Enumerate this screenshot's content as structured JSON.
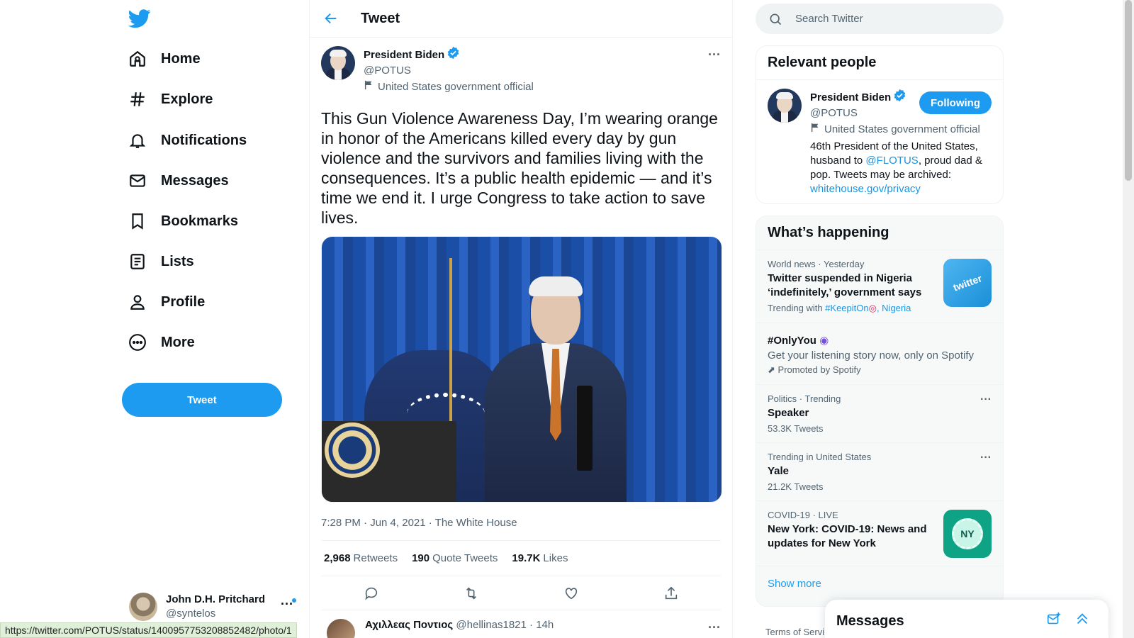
{
  "nav": {
    "items": [
      {
        "label": "Home",
        "icon": "home-icon"
      },
      {
        "label": "Explore",
        "icon": "hashtag-icon"
      },
      {
        "label": "Notifications",
        "icon": "bell-icon"
      },
      {
        "label": "Messages",
        "icon": "envelope-icon"
      },
      {
        "label": "Bookmarks",
        "icon": "bookmark-icon"
      },
      {
        "label": "Lists",
        "icon": "list-icon"
      },
      {
        "label": "Profile",
        "icon": "person-icon"
      },
      {
        "label": "More",
        "icon": "more-circle-icon"
      }
    ],
    "tweet_button": "Tweet"
  },
  "account": {
    "name": "John D.H. Pritchard",
    "handle": "@syntelos"
  },
  "header": {
    "title": "Tweet"
  },
  "tweet": {
    "author_name": "President Biden",
    "author_handle": "@POTUS",
    "gov_label": "United States government official",
    "text": "This Gun Violence Awareness Day, I’m wearing orange in honor of the Americans killed every day by gun violence and the survivors and families living with the consequences. It’s a public health epidemic — and it’s time we end it. I urge Congress to take action to save lives.",
    "time": "7:28 PM · Jun 4, 2021 · ",
    "source": "The White House",
    "retweets_count": "2,968",
    "retweets_label": "Retweets",
    "quotes_count": "190",
    "quotes_label": "Quote Tweets",
    "likes_count": "19.7K",
    "likes_label": "Likes"
  },
  "reply": {
    "name": "Αχιλλεας Ποντιος",
    "handle": "@hellinas1821",
    "time": "· 14h"
  },
  "search": {
    "placeholder": "Search Twitter"
  },
  "relevant": {
    "title": "Relevant people",
    "name": "President Biden",
    "handle": "@POTUS",
    "gov_label": "United States government official",
    "bio_1": "46th President of the United States, husband to ",
    "bio_mention": "@FLOTUS",
    "bio_2": ", proud dad & pop. Tweets may be archived: ",
    "bio_link": "whitehouse.gov/privacy",
    "follow_label": "Following"
  },
  "happening": {
    "title": "What’s happening",
    "trends": [
      {
        "context": "World news · Yesterday",
        "title": "Twitter suspended in Nigeria ‘indefinitely,’ government says",
        "trending_with": "Trending with ",
        "tags": "#KeepitOn",
        "tags2": ", Nigeria"
      },
      {
        "title": "#OnlyYou",
        "desc": "Get your listening story now, only on Spotify",
        "promoted": "Promoted by Spotify"
      },
      {
        "context": "Politics · Trending",
        "title": "Speaker",
        "count": "53.3K Tweets"
      },
      {
        "context": "Trending in United States",
        "title": "Yale",
        "count": "21.2K Tweets"
      },
      {
        "context": "COVID-19 · LIVE",
        "title": "New York: COVID-19: News and updates for New York",
        "thumb_text": "NY"
      }
    ],
    "show_more": "Show more",
    "thumb1_text": "twitter"
  },
  "footer": {
    "terms": "Terms of Servi"
  },
  "messages": {
    "title": "Messages"
  },
  "status_url": "https://twitter.com/POTUS/status/1400957753208852482/photo/1",
  "colors": {
    "accent": "#1d9bf0",
    "text": "#0f1419",
    "secondary": "#536471"
  }
}
